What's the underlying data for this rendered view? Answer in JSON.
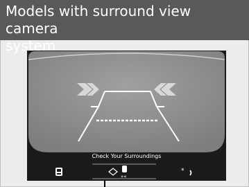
{
  "header": {
    "title": "Models with surround view camera\nsystem"
  },
  "camera_screen": {
    "status_message": "Check Your Surroundings",
    "icons": [
      "car-icon",
      "parking-sensor-icon",
      "brightness-icon",
      "night-mode-icon"
    ]
  },
  "colors": {
    "header_bg": "#595959",
    "page_bg": "#ececec",
    "screen_bg": "#1a1a1a",
    "camera_bg": "#909090",
    "guide_line": "#ffffff"
  }
}
